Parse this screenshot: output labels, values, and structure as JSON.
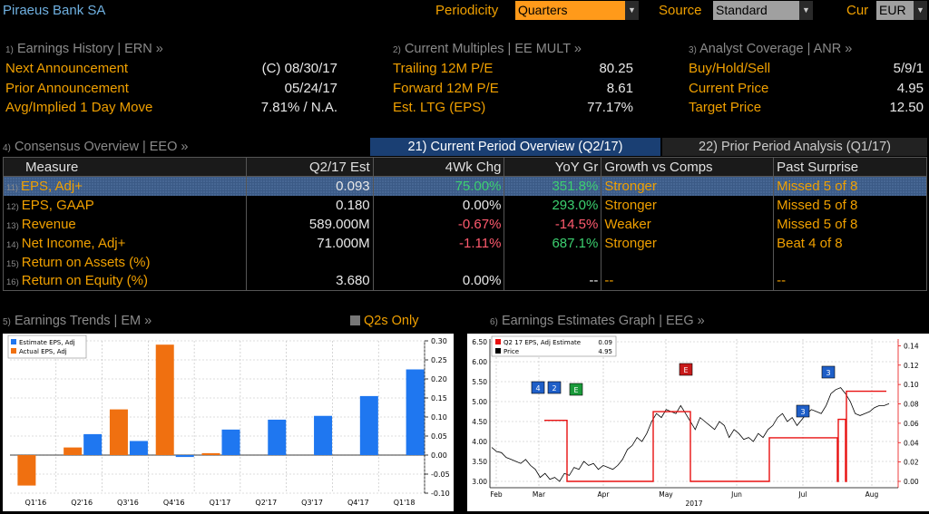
{
  "header": {
    "company": "Piraeus Bank SA",
    "periodicity_label": "Periodicity",
    "periodicity_value": "Quarters",
    "source_label": "Source",
    "source_value": "Standard",
    "cur_label": "Cur",
    "cur_value": "EUR"
  },
  "earnings_history": {
    "num": "1)",
    "title": "Earnings History | ERN »",
    "rows": [
      {
        "label": "Next Announcement",
        "value": "(C)  08/30/17"
      },
      {
        "label": "Prior Announcement",
        "value": "05/24/17"
      },
      {
        "label": "Avg/Implied 1 Day Move",
        "value": "7.81% / N.A."
      }
    ]
  },
  "current_multiples": {
    "num": "2)",
    "title": "Current Multiples | EE MULT »",
    "rows": [
      {
        "label": "Trailing 12M P/E",
        "value": "80.25"
      },
      {
        "label": "Forward 12M P/E",
        "value": "8.61"
      },
      {
        "label": "Est. LTG (EPS)",
        "value": "77.17%"
      }
    ]
  },
  "analyst_coverage": {
    "num": "3)",
    "title": "Analyst Coverage | ANR »",
    "rows": [
      {
        "label": "Buy/Hold/Sell",
        "value": "5/9/1"
      },
      {
        "label": "Current Price",
        "value": "4.95"
      },
      {
        "label": "Target Price",
        "value": "12.50"
      }
    ]
  },
  "consensus": {
    "num": "4)",
    "title": "Consensus Overview | EEO »",
    "tab_active": "21) Current Period Overview (Q2/17)",
    "tab_inactive": "22) Prior Period Analysis (Q1/17)",
    "columns": [
      "Measure",
      "Q2/17 Est",
      "4Wk Chg",
      "YoY Gr",
      "Growth vs Comps",
      "Past Surprise"
    ],
    "rows": [
      {
        "n": "11)",
        "measure": "EPS, Adj+",
        "est": "0.093",
        "chg": "75.00%",
        "yoy": "351.8%",
        "comps": "Stronger",
        "surprise": "Missed 5 of 8"
      },
      {
        "n": "12)",
        "measure": "EPS, GAAP",
        "est": "0.180",
        "chg": "0.00%",
        "yoy": "293.0%",
        "comps": "Stronger",
        "surprise": "Missed 5 of 8"
      },
      {
        "n": "13)",
        "measure": "Revenue",
        "est": "589.000M",
        "chg": "-0.67%",
        "yoy": "-14.5%",
        "comps": "Weaker",
        "surprise": "Missed 5 of 8"
      },
      {
        "n": "14)",
        "measure": "Net Income, Adj+",
        "est": "71.000M",
        "chg": "-1.11%",
        "yoy": "687.1%",
        "comps": "Stronger",
        "surprise": "Beat 4 of 8"
      },
      {
        "n": "15)",
        "measure": "Return on Assets (%)",
        "est": "",
        "chg": "",
        "yoy": "",
        "comps": "",
        "surprise": ""
      },
      {
        "n": "16)",
        "measure": "Return on Equity (%)",
        "est": "3.680",
        "chg": "0.00%",
        "yoy": "--",
        "comps": "--",
        "surprise": "--"
      }
    ]
  },
  "earnings_trends": {
    "num": "5)",
    "title": "Earnings Trends | EM »",
    "toggle_label": "Q2s Only"
  },
  "earnings_graph": {
    "num": "6)",
    "title": "Earnings Estimates Graph | EEG »"
  },
  "chart_data": [
    {
      "type": "bar",
      "categories": [
        "Q1'16",
        "Q2'16",
        "Q3'16",
        "Q4'16",
        "Q1'17",
        "Q2'17",
        "Q3'17",
        "Q4'17",
        "Q1'18"
      ],
      "series": [
        {
          "name": "Estimate EPS, Adj",
          "color": "#1f77f0",
          "values": [
            null,
            0.055,
            0.037,
            -0.005,
            0.067,
            0.093,
            0.103,
            0.155,
            0.225
          ]
        },
        {
          "name": "Actual EPS, Adj",
          "color": "#f07010",
          "values": [
            -0.08,
            0.02,
            0.12,
            0.29,
            0.005,
            null,
            null,
            null,
            null
          ]
        }
      ],
      "ylim": [
        -0.1,
        0.3
      ],
      "yticks": [
        "0.30",
        "0.25",
        "0.20",
        "0.15",
        "0.10",
        "0.05",
        "0.00",
        "-0.05",
        "-0.10"
      ]
    },
    {
      "type": "line",
      "x_labels": [
        "Feb",
        "Mar",
        "Apr",
        "May",
        "Jun",
        "Jul",
        "Aug"
      ],
      "x_year": "2017",
      "series": [
        {
          "name": "Q2 17 EPS, Adj Estimate",
          "color": "#e81010",
          "last": "0.09"
        },
        {
          "name": "Price",
          "color": "#000000",
          "last": "4.95"
        }
      ],
      "left_ticks": [
        "6.50",
        "6.00",
        "5.50",
        "5.00",
        "4.50",
        "4.00",
        "3.50",
        "3.00"
      ],
      "right_ticks": [
        "0.14",
        "0.12",
        "0.10",
        "0.08",
        "0.06",
        "0.04",
        "0.02",
        "0.00"
      ],
      "markers": [
        "4",
        "2",
        "E",
        "E",
        "3",
        "3"
      ]
    }
  ]
}
